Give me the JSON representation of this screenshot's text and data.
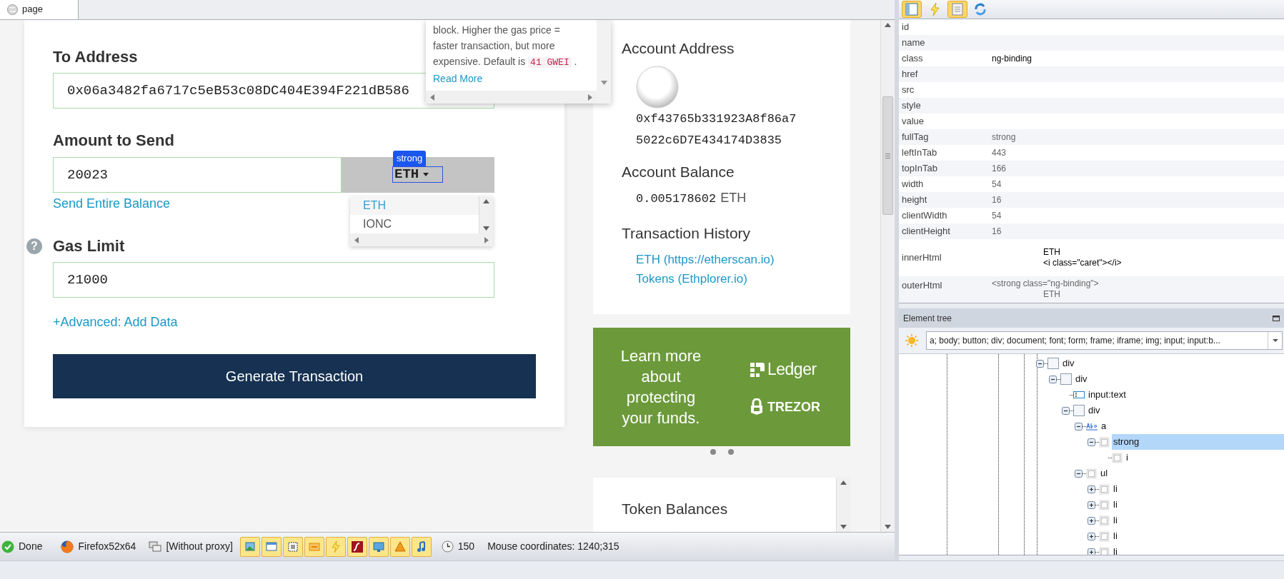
{
  "browser_tab": {
    "title": "page"
  },
  "gas_tooltip": {
    "text": "block. Higher the gas price = faster transaction, but more expensive. Default is",
    "code": "41 GWEI",
    "after": ".",
    "link": "Read More"
  },
  "send_form": {
    "to_address": {
      "label": "To Address",
      "value": "0x06a3482fa6717c5eB53c08DC404E394F221dB586"
    },
    "amount": {
      "label": "Amount to Send",
      "value": "20023",
      "unit": "ETH",
      "inspector_badge": "strong",
      "link": "Send Entire Balance"
    },
    "unit_menu": [
      {
        "label": "ETH",
        "selected": true
      },
      {
        "label": "IONC",
        "selected": false
      }
    ],
    "gas_limit": {
      "label": "Gas Limit",
      "help_icon": "?",
      "value": "21000"
    },
    "advanced_link": "+Advanced: Add Data",
    "submit": "Generate Transaction"
  },
  "account": {
    "address_heading": "Account Address",
    "address_lines": [
      "0xf43765b331923A8f86a7",
      "5022c6D7E434174D3835"
    ],
    "balance_heading": "Account Balance",
    "balance_value": "0.005178602",
    "balance_unit": "ETH",
    "history_heading": "Transaction History",
    "history_links": [
      "ETH (https://etherscan.io)",
      "Tokens (Ethplorer.io)"
    ]
  },
  "promo": {
    "text": "Learn more about protecting your funds.",
    "brands": [
      "Ledger",
      "TREZOR"
    ]
  },
  "token_balances": {
    "heading": "Token Balances"
  },
  "status_bar": {
    "status": "Done",
    "browser": "Firefox52x64",
    "proxy": "[Without proxy]",
    "toggles": [
      {
        "kind": "image"
      },
      {
        "kind": "window"
      },
      {
        "kind": "frame"
      },
      {
        "kind": "css"
      },
      {
        "kind": "script"
      },
      {
        "kind": "flash"
      },
      {
        "kind": "screen"
      },
      {
        "kind": "alert"
      },
      {
        "kind": "music"
      }
    ],
    "timer": "150",
    "mouse": "Mouse coordinates: 1240;315"
  },
  "inspector_toolbar": [
    {
      "kind": "layout",
      "selected": true
    },
    {
      "kind": "events",
      "selected": false
    },
    {
      "kind": "properties",
      "selected": true
    },
    {
      "kind": "refresh",
      "selected": false
    }
  ],
  "properties": [
    {
      "name": "id"
    },
    {
      "name": "name"
    },
    {
      "name": "class",
      "value": "ng-binding",
      "emphasized": true
    },
    {
      "name": "href"
    },
    {
      "name": "src"
    },
    {
      "name": "style"
    },
    {
      "name": "value"
    },
    {
      "name": "fullTag",
      "value": "strong",
      "emphasized": false
    },
    {
      "name": "leftInTab",
      "value": "443",
      "emphasized": false
    },
    {
      "name": "topInTab",
      "value": "166",
      "emphasized": false
    },
    {
      "name": "width",
      "value": "54",
      "emphasized": false
    },
    {
      "name": "height",
      "value": "16",
      "emphasized": false
    },
    {
      "name": "clientWidth",
      "value": "54",
      "emphasized": false
    },
    {
      "name": "clientHeight",
      "value": "16",
      "emphasized": false
    },
    {
      "name": "innerHtml",
      "emphasized": true,
      "lines": [
        {
          "text": "ETH",
          "indent": true
        },
        {
          "text": "<i class=\"caret\"></i>",
          "indent": true
        }
      ]
    },
    {
      "name": "outerHtml",
      "emphasized": false,
      "lines": [
        {
          "text": "<strong class=\"ng-binding\">",
          "indent": false
        },
        {
          "text": "ETH",
          "indent": true
        }
      ]
    }
  ],
  "element_tree": {
    "title": "Element tree",
    "filter": "a; body; button; div; document; font; form; frame; iframe; img; input; input:b...",
    "nodes": [
      {
        "tag": "div",
        "kind": "element",
        "expanded": true,
        "selected": false,
        "children": [
          {
            "tag": "div",
            "kind": "element",
            "expanded": true,
            "selected": false,
            "children": [
              {
                "tag": "input:text",
                "kind": "input",
                "selected": false
              },
              {
                "tag": "div",
                "kind": "element",
                "expanded": true,
                "selected": false,
                "children": [
                  {
                    "tag": "a",
                    "kind": "link",
                    "expanded": true,
                    "selected": false,
                    "children": [
                      {
                        "tag": "strong",
                        "kind": "inline",
                        "expanded": true,
                        "selected": true,
                        "children": [
                          {
                            "tag": "i",
                            "kind": "inline",
                            "selected": false
                          }
                        ]
                      }
                    ]
                  },
                  {
                    "tag": "ul",
                    "kind": "inline",
                    "expanded": true,
                    "selected": false,
                    "children": [
                      {
                        "tag": "li",
                        "kind": "inline",
                        "expanded": false,
                        "selected": false
                      },
                      {
                        "tag": "li",
                        "kind": "inline",
                        "expanded": false,
                        "selected": false
                      },
                      {
                        "tag": "li",
                        "kind": "inline",
                        "expanded": false,
                        "selected": false
                      },
                      {
                        "tag": "li",
                        "kind": "inline",
                        "expanded": false,
                        "selected": false
                      },
                      {
                        "tag": "li",
                        "kind": "inline",
                        "expanded": false,
                        "selected": false
                      }
                    ]
                  }
                ]
              }
            ]
          }
        ]
      }
    ]
  }
}
